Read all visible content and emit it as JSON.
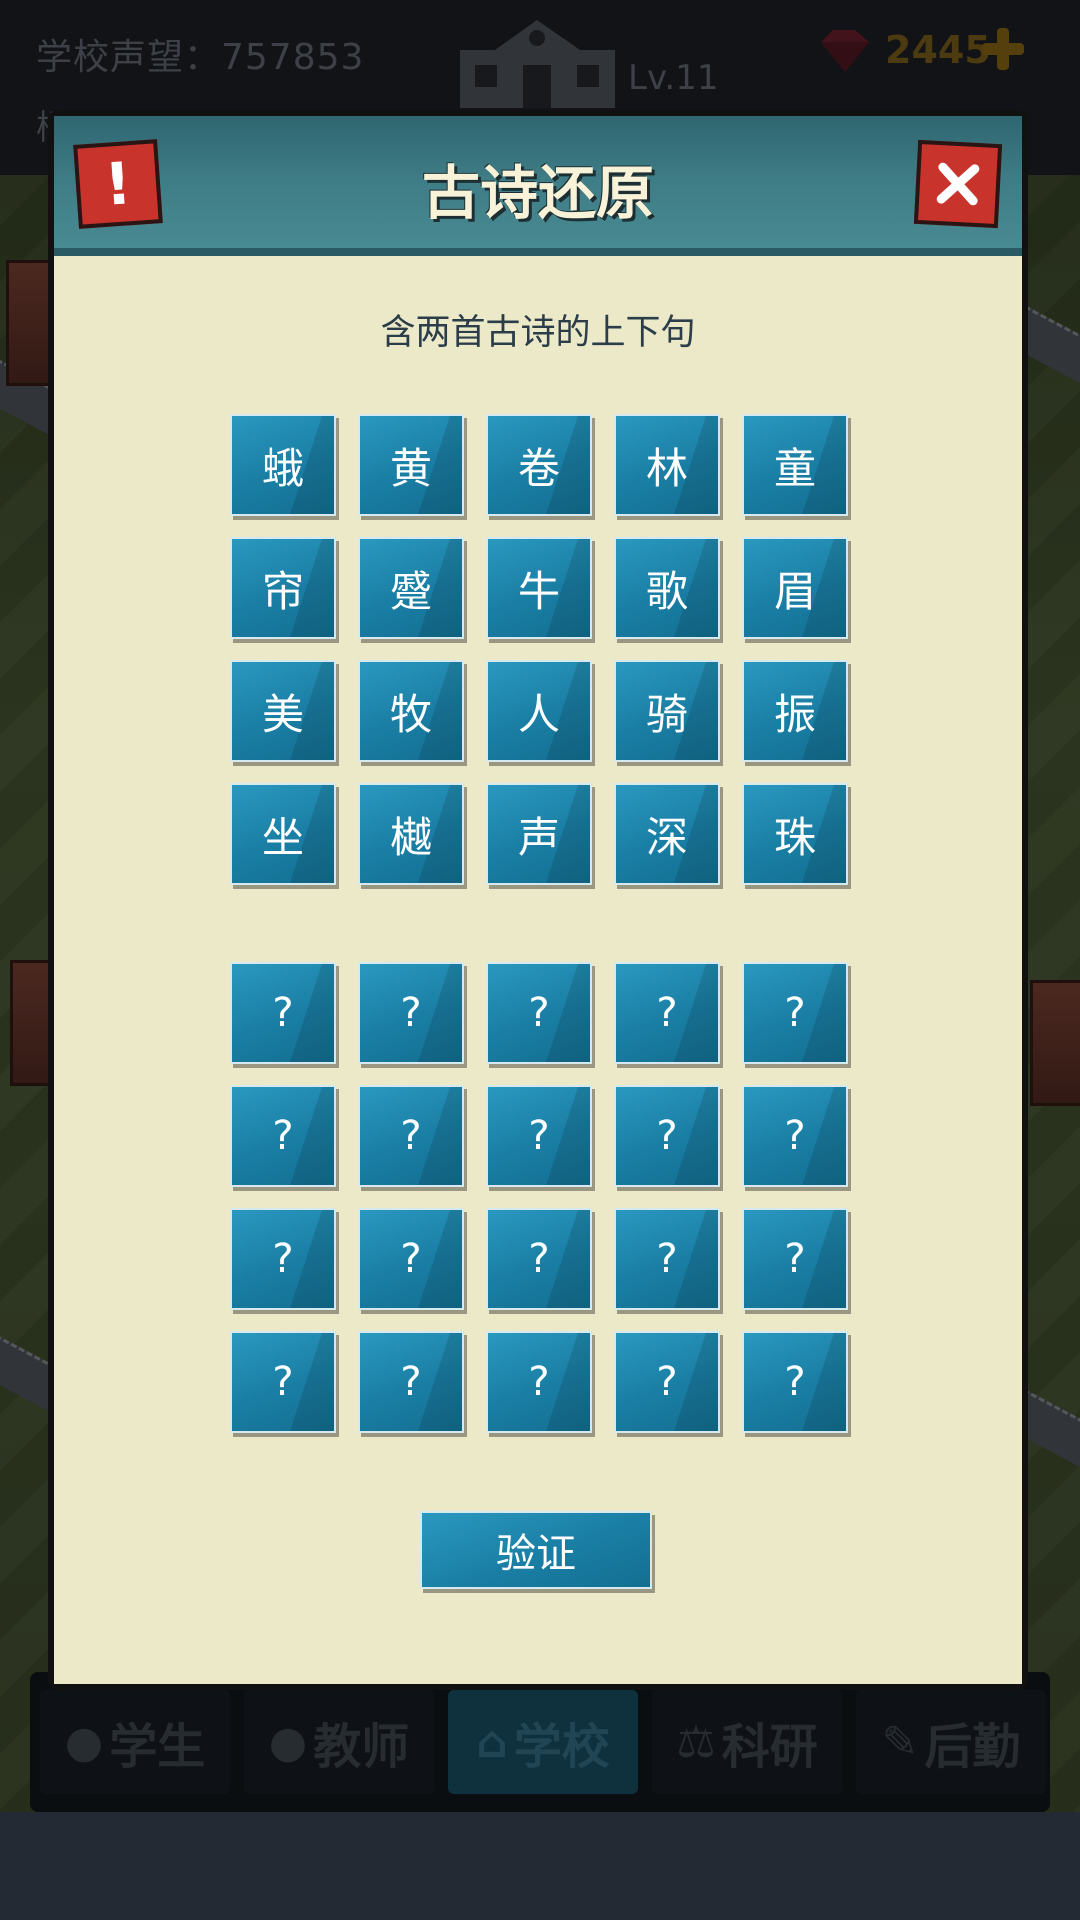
{
  "hud": {
    "reputation_text": "学校声望：757853",
    "level": "Lv.11",
    "gems": "2445",
    "second_row_char": "楼"
  },
  "dialog": {
    "title": "古诗还原",
    "alert_label": "!",
    "subtitle": "含两首古诗的上下句",
    "characters": [
      "蛾",
      "黄",
      "卷",
      "林",
      "童",
      "帘",
      "蹙",
      "牛",
      "歌",
      "眉",
      "美",
      "牧",
      "人",
      "骑",
      "振",
      "坐",
      "樾",
      "声",
      "深",
      "珠"
    ],
    "slots": [
      "?",
      "?",
      "?",
      "?",
      "?",
      "?",
      "?",
      "?",
      "?",
      "?",
      "?",
      "?",
      "?",
      "?",
      "?",
      "?",
      "?",
      "?",
      "?",
      "?"
    ],
    "verify_label": "验证"
  },
  "bottom_nav": {
    "tabs": [
      {
        "label": "学生",
        "icon": "student-icon"
      },
      {
        "label": "教师",
        "icon": "teacher-icon"
      },
      {
        "label": "学校",
        "icon": "school-icon",
        "active": true
      },
      {
        "label": "科研",
        "icon": "research-icon"
      },
      {
        "label": "后勤",
        "icon": "logistics-icon"
      }
    ]
  },
  "colors": {
    "tile": "#1a7ea4",
    "dialog_bg": "#ece9c8",
    "header": "#3e7c86",
    "close": "#c8332c"
  }
}
